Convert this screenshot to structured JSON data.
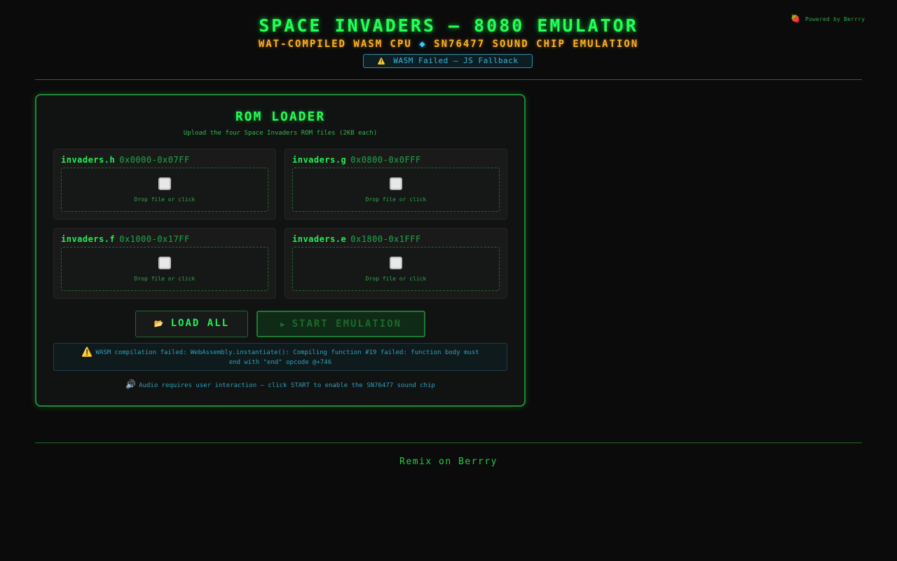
{
  "header": {
    "powered_icon": "strawberry-icon",
    "powered_by": "Powered by Berrry",
    "title": "SPACE INVADERS — 8080 EMULATOR",
    "subtitle_left": "WAT-COMPILED WASM CPU",
    "subtitle_separator": "◆",
    "subtitle_right": "SN76477 SOUND CHIP EMULATION",
    "status_icon": "warning-icon",
    "status_text": "WASM Failed — JS Fallback"
  },
  "rom_loader": {
    "title": "ROM LOADER",
    "subtitle": "Upload the four Space Invaders ROM files (2KB each)",
    "roms": [
      {
        "name": "invaders.h",
        "range": "0x0000-0x07FF",
        "drop_text": "Drop file or click",
        "icon": "file-icon"
      },
      {
        "name": "invaders.g",
        "range": "0x0800-0x0FFF",
        "drop_text": "Drop file or click",
        "icon": "file-icon"
      },
      {
        "name": "invaders.f",
        "range": "0x1000-0x17FF",
        "drop_text": "Drop file or click",
        "icon": "file-icon"
      },
      {
        "name": "invaders.e",
        "range": "0x1800-0x1FFF",
        "drop_text": "Drop file or click",
        "icon": "file-icon"
      }
    ],
    "load_all_label": "LOAD ALL",
    "load_all_icon": "folder-icon",
    "start_label": "START EMULATION",
    "start_icon": "play-icon",
    "error_text": "WASM compilation failed: WebAssembly.instantiate(): Compiling function #19 failed: function body must end with \"end\" opcode @+746",
    "audio_note": "Audio requires user interaction — click START to enable the SN76477 sound chip"
  },
  "footer": {
    "remix_label": "Remix on Berrry"
  },
  "colors": {
    "background": "#0b0b0b",
    "accent_green": "#22ff55",
    "accent_amber": "#ffb020",
    "accent_cyan": "#36b6d6"
  }
}
